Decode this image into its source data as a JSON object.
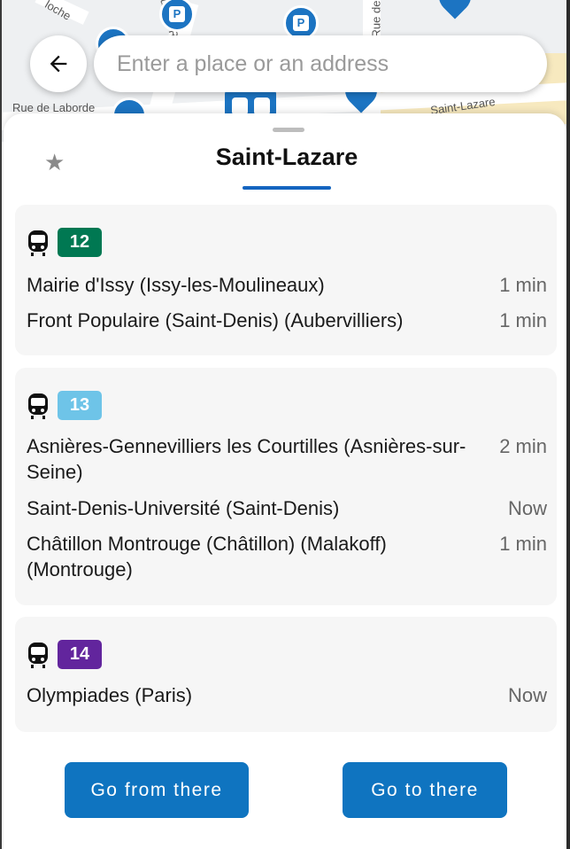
{
  "map": {
    "road_labels": [
      "Rue de Laborde",
      "Saint-Lazare",
      "Rue de Ro",
      "Rue de",
      "loche"
    ],
    "parking_label": "P"
  },
  "search": {
    "placeholder": "Enter a place or an address",
    "back_icon": "arrow-left-icon"
  },
  "sheet": {
    "title": "Saint-Lazare",
    "favorite_icon": "star-icon"
  },
  "lines": [
    {
      "line": "12",
      "color": "#007852",
      "text_color": "#ffffff",
      "departures": [
        {
          "destination": "Mairie d'Issy (Issy-les-Moulineaux)",
          "time": "1 min"
        },
        {
          "destination": "Front Populaire (Saint-Denis) (Aubervilliers)",
          "time": "1 min"
        }
      ]
    },
    {
      "line": "13",
      "color": "#6EC4E8",
      "text_color": "#ffffff",
      "departures": [
        {
          "destination": "Asnières-Gennevilliers les Courtilles (Asnières-sur-Seine)",
          "time": "2 min"
        },
        {
          "destination": "Saint-Denis-Université (Saint-Denis)",
          "time": "Now"
        },
        {
          "destination": "Châtillon Montrouge (Châtillon) (Malakoff) (Montrouge)",
          "time": "1 min"
        }
      ]
    },
    {
      "line": "14",
      "color": "#62259D",
      "text_color": "#ffffff",
      "departures": [
        {
          "destination": "Olympiades (Paris)",
          "time": "Now"
        }
      ]
    }
  ],
  "actions": {
    "go_from": "Go from there",
    "go_to": "Go to there"
  },
  "colors": {
    "accent": "#0f74c0",
    "tab_underline": "#1565c0"
  }
}
